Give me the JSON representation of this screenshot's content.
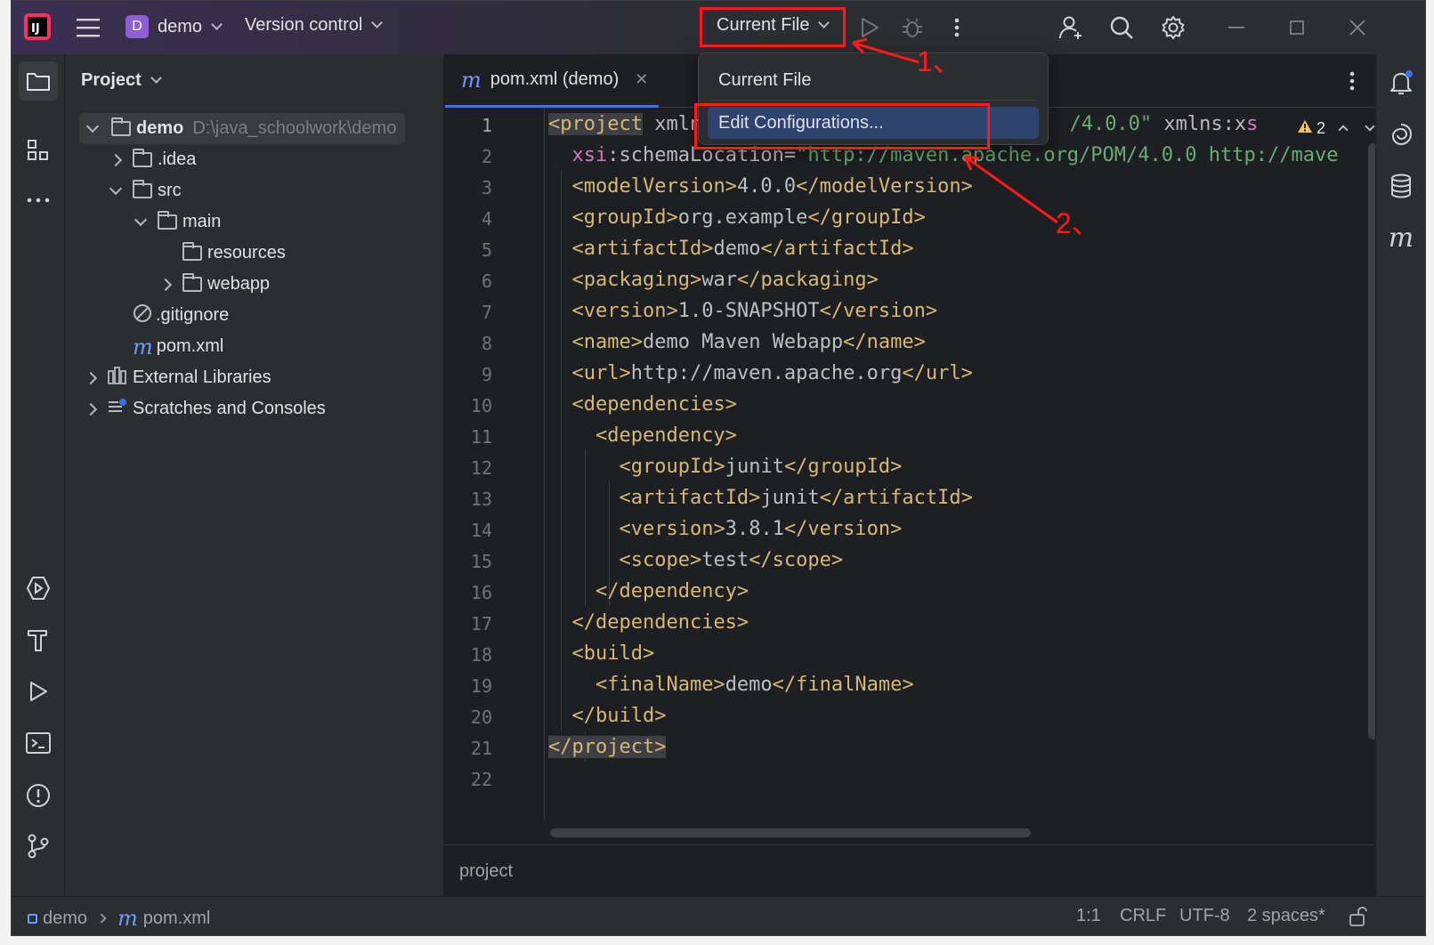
{
  "titlebar": {
    "project_badge": "D",
    "project_name": "demo",
    "version_control": "Version control",
    "run_config": "Current File",
    "icons": [
      "intellij-logo",
      "hamburger-menu",
      "run",
      "debug",
      "more-vertical",
      "add-user",
      "search",
      "settings",
      "minimize",
      "maximize",
      "close"
    ]
  },
  "left_strip_icons_top": [
    "project-folder",
    "structure",
    "more-horizontal"
  ],
  "left_strip_icons_bottom": [
    "services",
    "build-hammer",
    "run",
    "terminal",
    "problems",
    "git"
  ],
  "right_strip_icons": [
    "notifications-bell",
    "ai-assistant",
    "database",
    "maven"
  ],
  "project_panel": {
    "title": "Project",
    "tree": [
      {
        "label": "demo",
        "path": "D:\\java_schoolwork\\demo"
      },
      {
        "label": ".idea"
      },
      {
        "label": "src"
      },
      {
        "label": "main"
      },
      {
        "label": "resources"
      },
      {
        "label": "webapp"
      },
      {
        "label": ".gitignore"
      },
      {
        "label": "pom.xml"
      },
      {
        "label": "External Libraries"
      },
      {
        "label": "Scratches and Consoles"
      }
    ]
  },
  "editor": {
    "tab_label": "pom.xml (demo)",
    "tab_icon": "m",
    "warning_count": "2",
    "line_numbers": [
      "1",
      "2",
      "3",
      "4",
      "5",
      "6",
      "7",
      "8",
      "9",
      "10",
      "11",
      "12",
      "13",
      "14",
      "15",
      "16",
      "17",
      "18",
      "19",
      "20",
      "21",
      "22"
    ],
    "breadcrumb": "project"
  },
  "popup": {
    "items": [
      "Current File",
      "Edit Configurations..."
    ],
    "selected": "Edit Configurations..."
  },
  "annotations": {
    "label_1": "1、",
    "label_2": "2、",
    "color": "#ff1a1a"
  },
  "statusbar": {
    "crumb_project": "demo",
    "crumb_file": "pom.xml",
    "position": "1:1",
    "line_sep": "CRLF",
    "encoding": "UTF-8",
    "indent": "2 spaces*"
  },
  "colors": {
    "tag": "#d5b778",
    "string": "#6aab73",
    "namespace": "#c77dbb",
    "selection": "#2e436e",
    "accent": "#3574f0"
  }
}
